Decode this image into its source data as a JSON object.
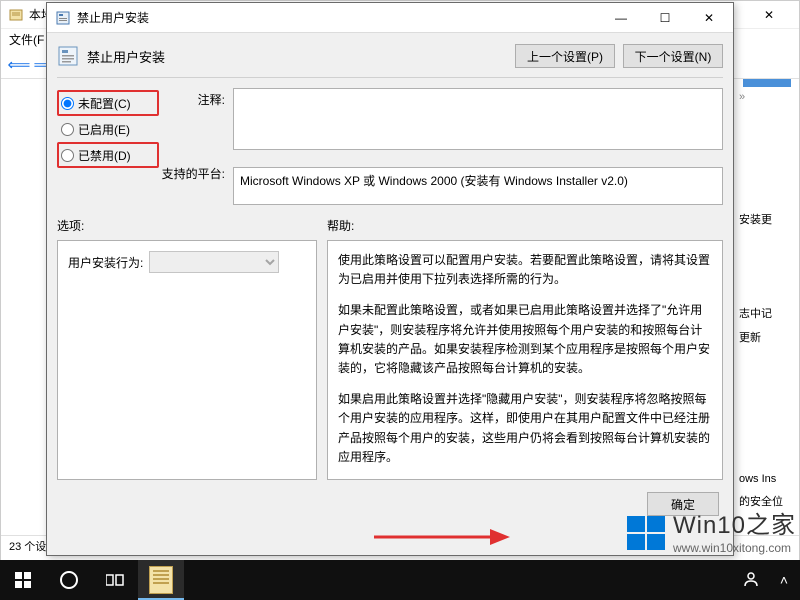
{
  "bg_window": {
    "title": "本地组策略编辑器",
    "menu_file": "文件(F",
    "status": "23 个设",
    "right_items": [
      "安装更",
      "志中记",
      "更新",
      "ows Ins",
      "的安全位"
    ]
  },
  "dialog": {
    "title": "禁止用户安装",
    "header_title": "禁止用户安装",
    "prev_btn": "上一个设置(P)",
    "next_btn": "下一个设置(N)",
    "radio_unconfigured": "未配置(C)",
    "radio_enabled": "已启用(E)",
    "radio_disabled": "已禁用(D)",
    "comment_label": "注释:",
    "platform_label": "支持的平台:",
    "platform_text": "Microsoft Windows XP 或 Windows 2000 (安装有 Windows Installer v2.0)",
    "options_label": "选项:",
    "help_label": "帮助:",
    "option_field": "用户安装行为:",
    "help_p1": "使用此策略设置可以配置用户安装。若要配置此策略设置，请将其设置为已启用并使用下拉列表选择所需的行为。",
    "help_p2": "如果未配置此策略设置，或者如果已启用此策略设置并选择了\"允许用户安装\"，则安装程序将允许并使用按照每个用户安装的和按照每台计算机安装的产品。如果安装程序检测到某个应用程序是按照每个用户安装的，它将隐藏该产品按照每台计算机的安装。",
    "help_p3": "如果启用此策略设置并选择\"隐藏用户安装\"，则安装程序将忽略按照每个用户安装的应用程序。这样，即使用户在其用户配置文件中已经注册产品按照每个用户的安装，这些用户仍将会看到按照每台计算机安装的应用程序。",
    "ok_btn": "确定"
  },
  "watermark": {
    "brand": "Win10之家",
    "url": "www.win10xitong.com"
  },
  "window_controls": {
    "min": "—",
    "max": "☐",
    "close": "✕"
  }
}
